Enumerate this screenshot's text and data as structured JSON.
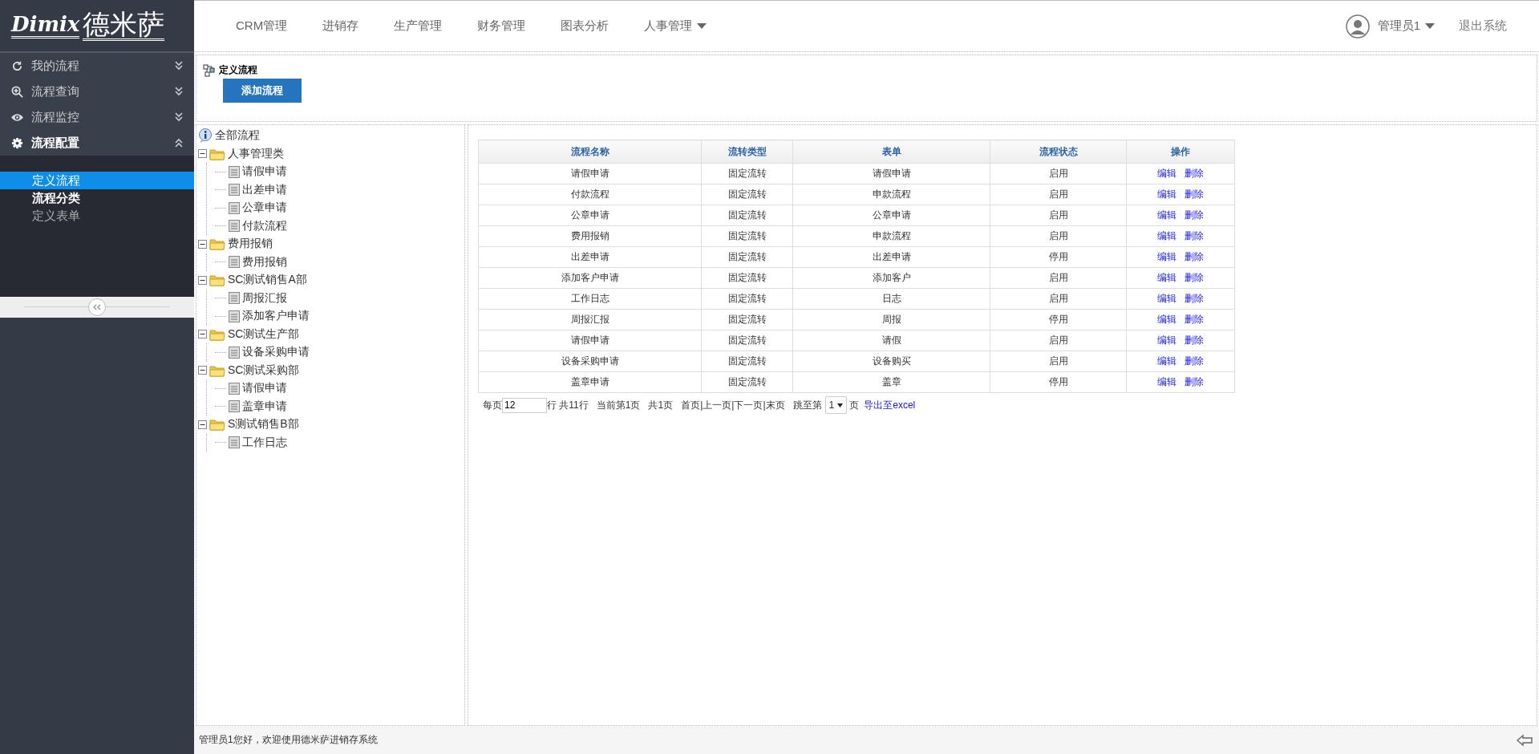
{
  "logo": {
    "latin": "Dimix",
    "name": "德米萨"
  },
  "nav": [
    {
      "label": "CRM管理",
      "dropdown": false
    },
    {
      "label": "进销存",
      "dropdown": false
    },
    {
      "label": "生产管理",
      "dropdown": false
    },
    {
      "label": "财务管理",
      "dropdown": false
    },
    {
      "label": "图表分析",
      "dropdown": false
    },
    {
      "label": "人事管理",
      "dropdown": true
    }
  ],
  "user": {
    "name": "管理员1",
    "logout": "退出系统"
  },
  "sidebar": {
    "menus": [
      {
        "label": "我的流程",
        "kind": "refresh",
        "expanded": false
      },
      {
        "label": "流程查询",
        "kind": "zoom",
        "expanded": false
      },
      {
        "label": "流程监控",
        "kind": "eye",
        "expanded": false
      },
      {
        "label": "流程配置",
        "kind": "gear",
        "expanded": true
      }
    ],
    "items": [
      {
        "label": "定义流程",
        "selected": true,
        "hovered": false
      },
      {
        "label": "流程分类",
        "selected": false,
        "hovered": true
      },
      {
        "label": "定义表单",
        "selected": false,
        "hovered": false
      }
    ]
  },
  "page": {
    "title": "定义流程",
    "add_button": "添加流程"
  },
  "tree": {
    "root": "全部流程",
    "folders": [
      {
        "label": "人事管理类",
        "expanded": true,
        "children": [
          {
            "label": "请假申请"
          },
          {
            "label": "出差申请"
          },
          {
            "label": "公章申请"
          },
          {
            "label": "付款流程"
          }
        ]
      },
      {
        "label": "费用报销",
        "expanded": true,
        "children": [
          {
            "label": "费用报销"
          }
        ]
      },
      {
        "label": "SC测试销售A部",
        "expanded": true,
        "children": [
          {
            "label": "周报汇报"
          },
          {
            "label": "添加客户申请"
          }
        ]
      },
      {
        "label": "SC测试生产部",
        "expanded": true,
        "children": [
          {
            "label": "设备采购申请"
          }
        ]
      },
      {
        "label": "SC测试采购部",
        "expanded": true,
        "children": [
          {
            "label": "请假申请"
          },
          {
            "label": "盖章申请"
          }
        ]
      },
      {
        "label": "S测试销售B部",
        "expanded": true,
        "children": [
          {
            "label": "工作日志"
          }
        ]
      }
    ]
  },
  "table": {
    "columns": [
      "流程名称",
      "流转类型",
      "表单",
      "流程状态",
      "操作"
    ],
    "rows": [
      {
        "name": "请假申请",
        "type": "固定流转",
        "form": "请假申请",
        "status": "启用",
        "actions": [
          "编辑",
          "删除"
        ]
      },
      {
        "name": "付款流程",
        "type": "固定流转",
        "form": "申款流程",
        "status": "启用",
        "actions": [
          "编辑",
          "删除"
        ]
      },
      {
        "name": "公章申请",
        "type": "固定流转",
        "form": "公章申请",
        "status": "启用",
        "actions": [
          "编辑",
          "删除"
        ]
      },
      {
        "name": "费用报销",
        "type": "固定流转",
        "form": "申款流程",
        "status": "启用",
        "actions": [
          "编辑",
          "删除"
        ]
      },
      {
        "name": "出差申请",
        "type": "固定流转",
        "form": "出差申请",
        "status": "停用",
        "actions": [
          "编辑",
          "删除"
        ]
      },
      {
        "name": "添加客户申请",
        "type": "固定流转",
        "form": "添加客户",
        "status": "启用",
        "actions": [
          "编辑",
          "删除"
        ]
      },
      {
        "name": "工作日志",
        "type": "固定流转",
        "form": "日志",
        "status": "启用",
        "actions": [
          "编辑",
          "删除"
        ]
      },
      {
        "name": "周报汇报",
        "type": "固定流转",
        "form": "周报",
        "status": "停用",
        "actions": [
          "编辑",
          "删除"
        ]
      },
      {
        "name": "请假申请",
        "type": "固定流转",
        "form": "请假",
        "status": "启用",
        "actions": [
          "编辑",
          "删除"
        ]
      },
      {
        "name": "设备采购申请",
        "type": "固定流转",
        "form": "设备购买",
        "status": "启用",
        "actions": [
          "编辑",
          "删除"
        ]
      },
      {
        "name": "盖章申请",
        "type": "固定流转",
        "form": "盖章",
        "status": "停用",
        "actions": [
          "编辑",
          "删除"
        ]
      }
    ]
  },
  "pager": {
    "per_page_label": "每页",
    "per_page": "12",
    "rows_total": "行 共11行",
    "current": "当前第1页",
    "pages_total": "共1页",
    "links": [
      "首页",
      "上一页",
      "下一页",
      "末页"
    ],
    "separator": "|",
    "jump_label": "跳至第",
    "page": "1",
    "page_suffix": "页",
    "export": "导出至excel"
  },
  "footer": {
    "welcome": "管理员1您好，欢迎使用德米萨进销存系统"
  }
}
